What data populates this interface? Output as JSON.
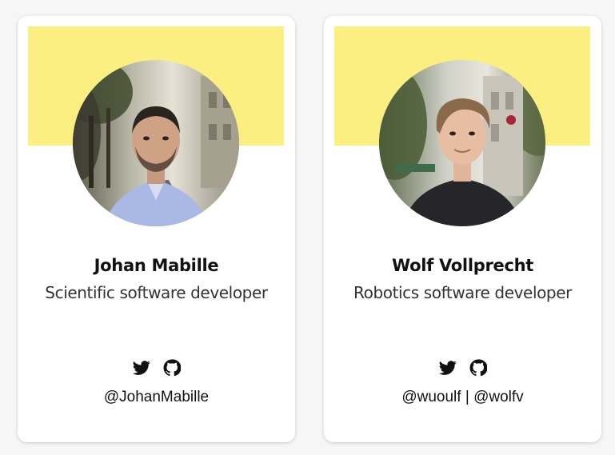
{
  "colors": {
    "banner": "#fbef81",
    "card": "#ffffff",
    "text": "#111111"
  },
  "cards": [
    {
      "name": "Johan Mabille",
      "role": "Scientific software developer",
      "icons": [
        "twitter-icon",
        "github-icon"
      ],
      "handles": [
        "@JohanMabille"
      ]
    },
    {
      "name": "Wolf Vollprecht",
      "role": "Robotics software developer",
      "icons": [
        "twitter-icon",
        "github-icon"
      ],
      "handles": [
        "@wuoulf",
        "@wolfv"
      ],
      "handle_separator": " | "
    }
  ]
}
